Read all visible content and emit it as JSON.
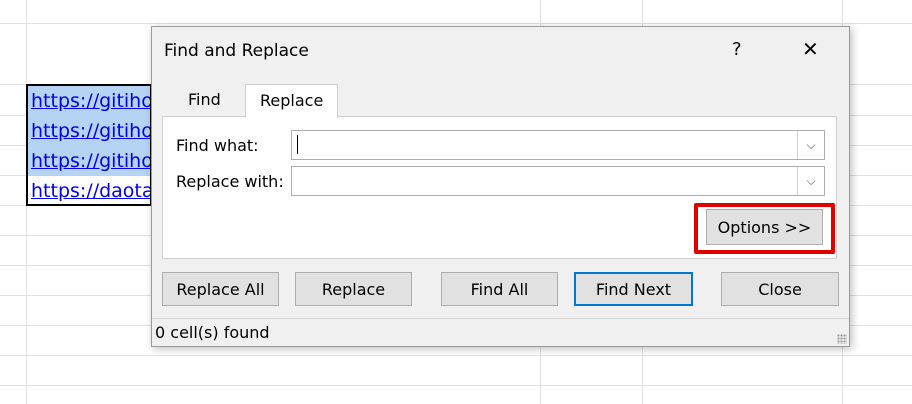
{
  "sheet": {
    "cells": [
      "https://gitiho",
      "https://gitiho",
      "https://gitiho",
      "https://daota"
    ]
  },
  "dialog": {
    "title": "Find and Replace",
    "help": "?",
    "close_icon": "✕",
    "tabs": [
      {
        "label": "Find"
      },
      {
        "label": "Replace"
      }
    ],
    "find_what_label": "Find what:",
    "replace_with_label": "Replace with:",
    "find_what_value": "",
    "replace_with_value": "",
    "options": "Options >>",
    "buttons": {
      "replace_all": "Replace All",
      "replace": "Replace",
      "find_all": "Find All",
      "find_next": "Find Next",
      "close": "Close"
    },
    "status": "0 cell(s) found",
    "highlight_color": "#e00000"
  }
}
